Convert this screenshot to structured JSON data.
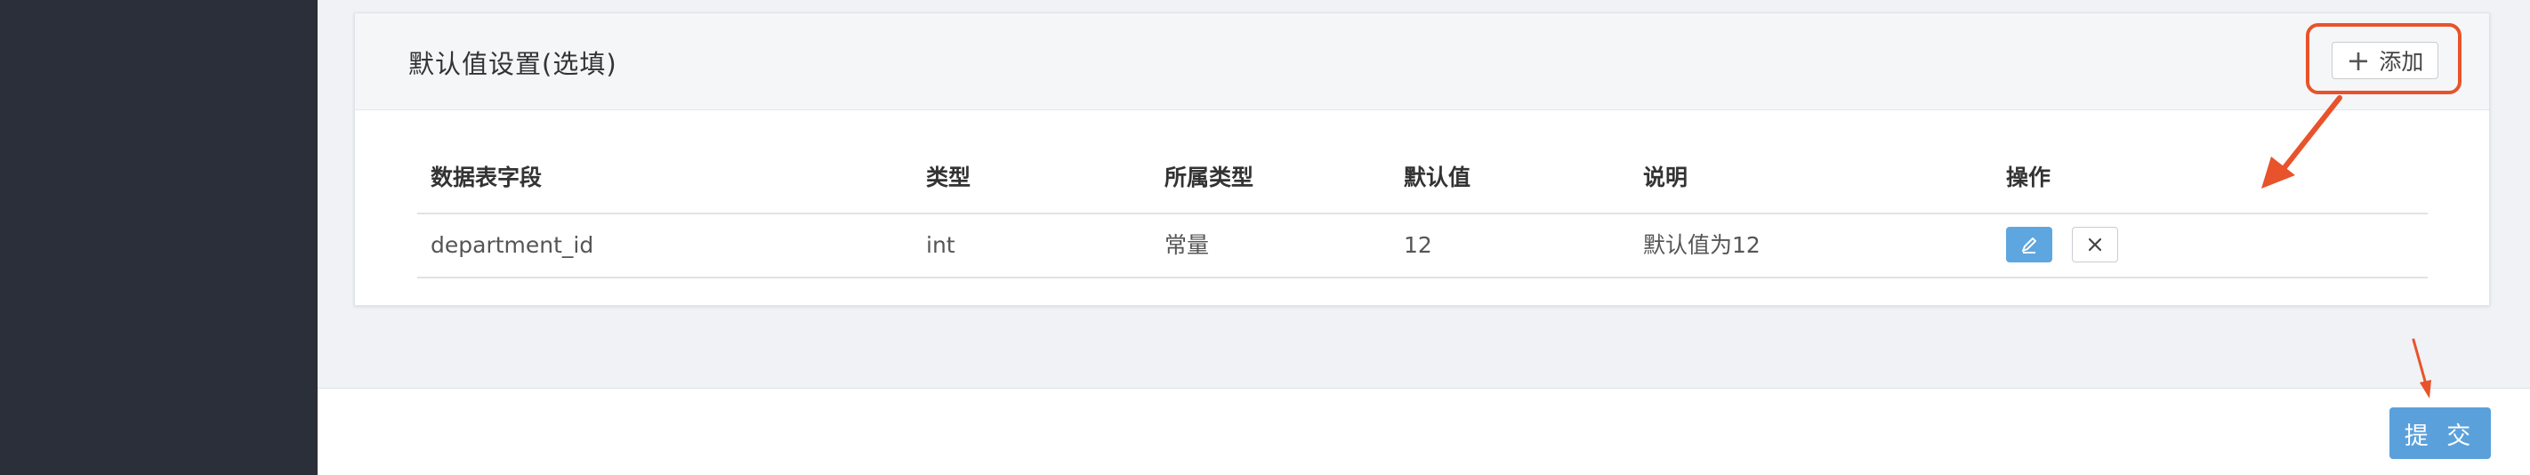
{
  "section": {
    "title": "默认值设置(选填)",
    "add_label": "添加"
  },
  "table": {
    "headers": [
      "数据表字段",
      "类型",
      "所属类型",
      "默认值",
      "说明",
      "操作"
    ],
    "rows": [
      [
        "department_id",
        "int",
        "常量",
        "12",
        "默认值为12"
      ]
    ]
  },
  "footer": {
    "submit_label": "提 交"
  },
  "colors": {
    "sidebar": "#2a2f3a",
    "primary": "#5aa1dc",
    "annotation": "#e8532b"
  },
  "icons": [
    "plus-icon",
    "edit-icon",
    "close-icon",
    "annotation-arrow"
  ]
}
